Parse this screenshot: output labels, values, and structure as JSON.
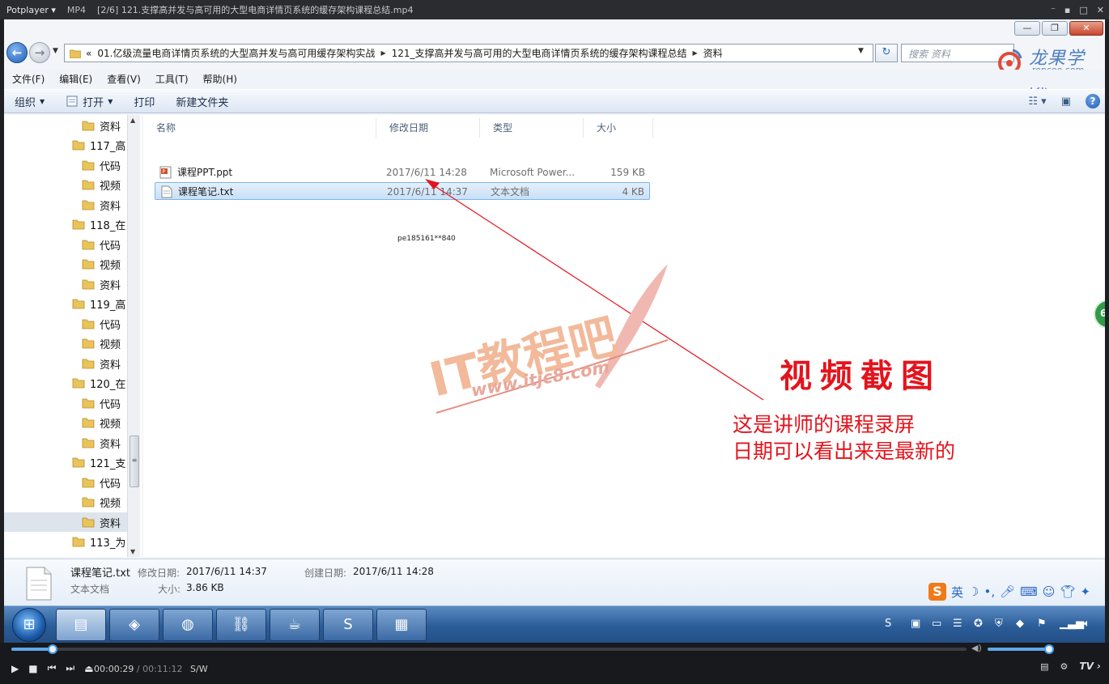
{
  "player": {
    "brand": "Potplayer",
    "format": "MP4",
    "filename": "[2/6] 121.支撑高并发与高可用的大型电商详情页系统的缓存架构课程总结.mp4",
    "win_ctrls": [
      "⁻",
      "▪",
      "□",
      "✕"
    ],
    "current_time": "00:00:29",
    "duration": "00:11:12",
    "mode": "S/W",
    "tv": "TV",
    "progress_fraction": 0.043,
    "volume_fraction": 1.0
  },
  "explorer": {
    "win_buttons": [
      "—",
      "❐",
      "✕"
    ],
    "address": {
      "overflow": "«",
      "segments": [
        "01.亿级流量电商详情页系统的大型高并发与高可用缓存架构实战",
        "121_支撑高并发与高可用的大型电商详情页系统的缓存架构课程总结",
        "资料"
      ]
    },
    "search_placeholder": "搜索 资料",
    "logo": {
      "name": "龙果学院",
      "url": "roncoo.com"
    },
    "menu": [
      "文件(F)",
      "编辑(E)",
      "查看(V)",
      "工具(T)",
      "帮助(H)"
    ],
    "toolbar": {
      "organize": "组织",
      "open": "打开",
      "print": "打印",
      "new_folder": "新建文件夹"
    },
    "tree": [
      {
        "label": "资料",
        "level": 2
      },
      {
        "label": "117_高",
        "level": 1
      },
      {
        "label": "代码",
        "level": 2
      },
      {
        "label": "视频",
        "level": 2
      },
      {
        "label": "资料",
        "level": 2
      },
      {
        "label": "118_在",
        "level": 1
      },
      {
        "label": "代码",
        "level": 2
      },
      {
        "label": "视频",
        "level": 2
      },
      {
        "label": "资料",
        "level": 2
      },
      {
        "label": "119_高",
        "level": 1
      },
      {
        "label": "代码",
        "level": 2
      },
      {
        "label": "视频",
        "level": 2
      },
      {
        "label": "资料",
        "level": 2
      },
      {
        "label": "120_在",
        "level": 1
      },
      {
        "label": "代码",
        "level": 2
      },
      {
        "label": "视频",
        "level": 2
      },
      {
        "label": "资料",
        "level": 2
      },
      {
        "label": "121_支",
        "level": 1
      },
      {
        "label": "代码",
        "level": 2
      },
      {
        "label": "视频",
        "level": 2
      },
      {
        "label": "资料",
        "level": 2,
        "selected": true
      },
      {
        "label": "113_为",
        "level": 1
      }
    ],
    "columns": {
      "name": "名称",
      "modified": "修改日期",
      "type": "类型",
      "size": "大小"
    },
    "files": [
      {
        "name": "课程PPT.ppt",
        "modified": "2017/6/11 14:28",
        "type": "Microsoft Power...",
        "size": "159 KB",
        "selected": false
      },
      {
        "name": "课程笔记.txt",
        "modified": "2017/6/11 14:37",
        "type": "文本文档",
        "size": "4 KB",
        "selected": true
      }
    ],
    "details": {
      "filename": "课程笔记.txt",
      "modified_label": "修改日期:",
      "modified": "2017/6/11 14:37",
      "created_label": "创建日期:",
      "created": "2017/6/11 14:28",
      "type": "文本文档",
      "size_label": "大小:",
      "size": "3.86 KB"
    }
  },
  "overlay": {
    "watermark_id": "pe185161**840",
    "site_logo_text": "IT教程吧",
    "site_logo_url": "www.itjc8.com",
    "annotation_title": "视频截图",
    "annotation_lines": [
      "这是讲师的课程录屏",
      "日期可以看出来是最新的"
    ],
    "side_tab": "6",
    "annotation_color": "#e3141d"
  },
  "taskbar": {
    "start_icon": "windows-orb",
    "tasks": [
      "explorer-icon",
      "virtualbox-icon",
      "dashboard-icon",
      "network-lock-icon",
      "javaee-ide-icon",
      "sublime-icon",
      "presentation-icon"
    ],
    "ime_label": "英"
  }
}
